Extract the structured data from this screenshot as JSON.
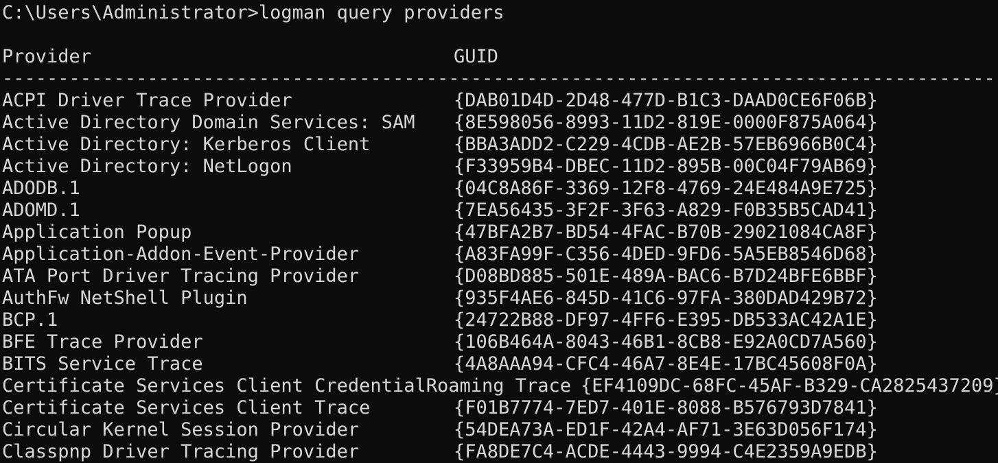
{
  "terminal": {
    "prompt": "C:\\Users\\Administrator>",
    "command": "logman query providers",
    "header": {
      "provider": "Provider",
      "guid": "GUID"
    },
    "separator": "-----------------------------------------------------------------------------------------------------------",
    "rows": [
      {
        "provider": "ACPI Driver Trace Provider",
        "guid": "{DAB01D4D-2D48-477D-B1C3-DAAD0CE6F06B}"
      },
      {
        "provider": "Active Directory Domain Services: SAM",
        "guid": "{8E598056-8993-11D2-819E-0000F875A064}"
      },
      {
        "provider": "Active Directory: Kerberos Client",
        "guid": "{BBA3ADD2-C229-4CDB-AE2B-57EB6966B0C4}"
      },
      {
        "provider": "Active Directory: NetLogon",
        "guid": "{F33959B4-DBEC-11D2-895B-00C04F79AB69}"
      },
      {
        "provider": "ADODB.1",
        "guid": "{04C8A86F-3369-12F8-4769-24E484A9E725}"
      },
      {
        "provider": "ADOMD.1",
        "guid": "{7EA56435-3F2F-3F63-A829-F0B35B5CAD41}"
      },
      {
        "provider": "Application Popup",
        "guid": "{47BFA2B7-BD54-4FAC-B70B-29021084CA8F}"
      },
      {
        "provider": "Application-Addon-Event-Provider",
        "guid": "{A83FA99F-C356-4DED-9FD6-5A5EB8546D68}"
      },
      {
        "provider": "ATA Port Driver Tracing Provider",
        "guid": "{D08BD885-501E-489A-BAC6-B7D24BFE6BBF}"
      },
      {
        "provider": "AuthFw NetShell Plugin",
        "guid": "{935F4AE6-845D-41C6-97FA-380DAD429B72}"
      },
      {
        "provider": "BCP.1",
        "guid": "{24722B88-DF97-4FF6-E395-DB533AC42A1E}"
      },
      {
        "provider": "BFE Trace Provider",
        "guid": "{106B464A-8043-46B1-8CB8-E92A0CD7A560}"
      },
      {
        "provider": "BITS Service Trace",
        "guid": "{4A8AAA94-CFC4-46A7-8E4E-17BC45608F0A}"
      },
      {
        "provider": "Certificate Services Client CredentialRoaming Trace",
        "guid": "{EF4109DC-68FC-45AF-B329-CA2825437209}"
      },
      {
        "provider": "Certificate Services Client Trace",
        "guid": "{F01B7774-7ED7-401E-8088-B576793D7841}"
      },
      {
        "provider": "Circular Kernel Session Provider",
        "guid": "{54DEA73A-ED1F-42A4-AF71-3E63D056F174}"
      },
      {
        "provider": "Classpnp Driver Tracing Provider",
        "guid": "{FA8DE7C4-ACDE-4443-9994-C4E2359A9EDB}"
      }
    ]
  },
  "colors": {
    "background": "#0c0c0c",
    "foreground": "#d6d6d6"
  }
}
